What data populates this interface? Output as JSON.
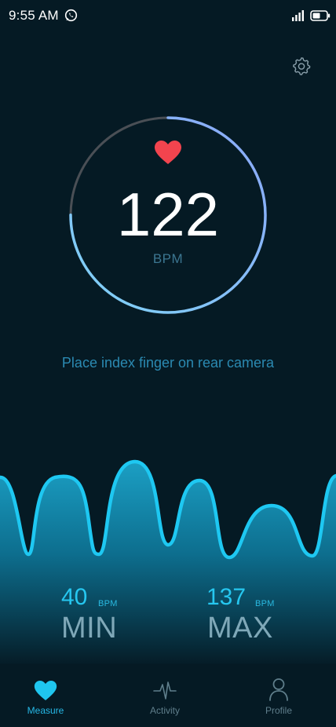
{
  "status_bar": {
    "time": "9:55 AM",
    "icons": [
      "whatsapp-icon",
      "signal-icon",
      "battery-icon"
    ]
  },
  "header": {
    "settings_icon": "gear-icon"
  },
  "gauge": {
    "value": "122",
    "unit": "BPM",
    "progress": 0.75,
    "colors": {
      "arc_start": "#6fcdf5",
      "arc_end": "#8aa8f8",
      "track": "#4a4f55",
      "heart": "#f2444e"
    }
  },
  "instruction": "Place index finger on rear camera",
  "stats": {
    "min": {
      "value": "40",
      "unit": "BPM",
      "label": "MIN"
    },
    "max": {
      "value": "137",
      "unit": "BPM",
      "label": "MAX"
    }
  },
  "bottom_nav": {
    "items": [
      {
        "label": "Measure",
        "icon": "heart-icon",
        "active": true
      },
      {
        "label": "Activity",
        "icon": "pulse-icon",
        "active": false
      },
      {
        "label": "Profile",
        "icon": "person-icon",
        "active": false
      }
    ]
  },
  "colors": {
    "background": "#051a24",
    "accent": "#26c7f0",
    "wave_line": "#1ec8f2"
  }
}
